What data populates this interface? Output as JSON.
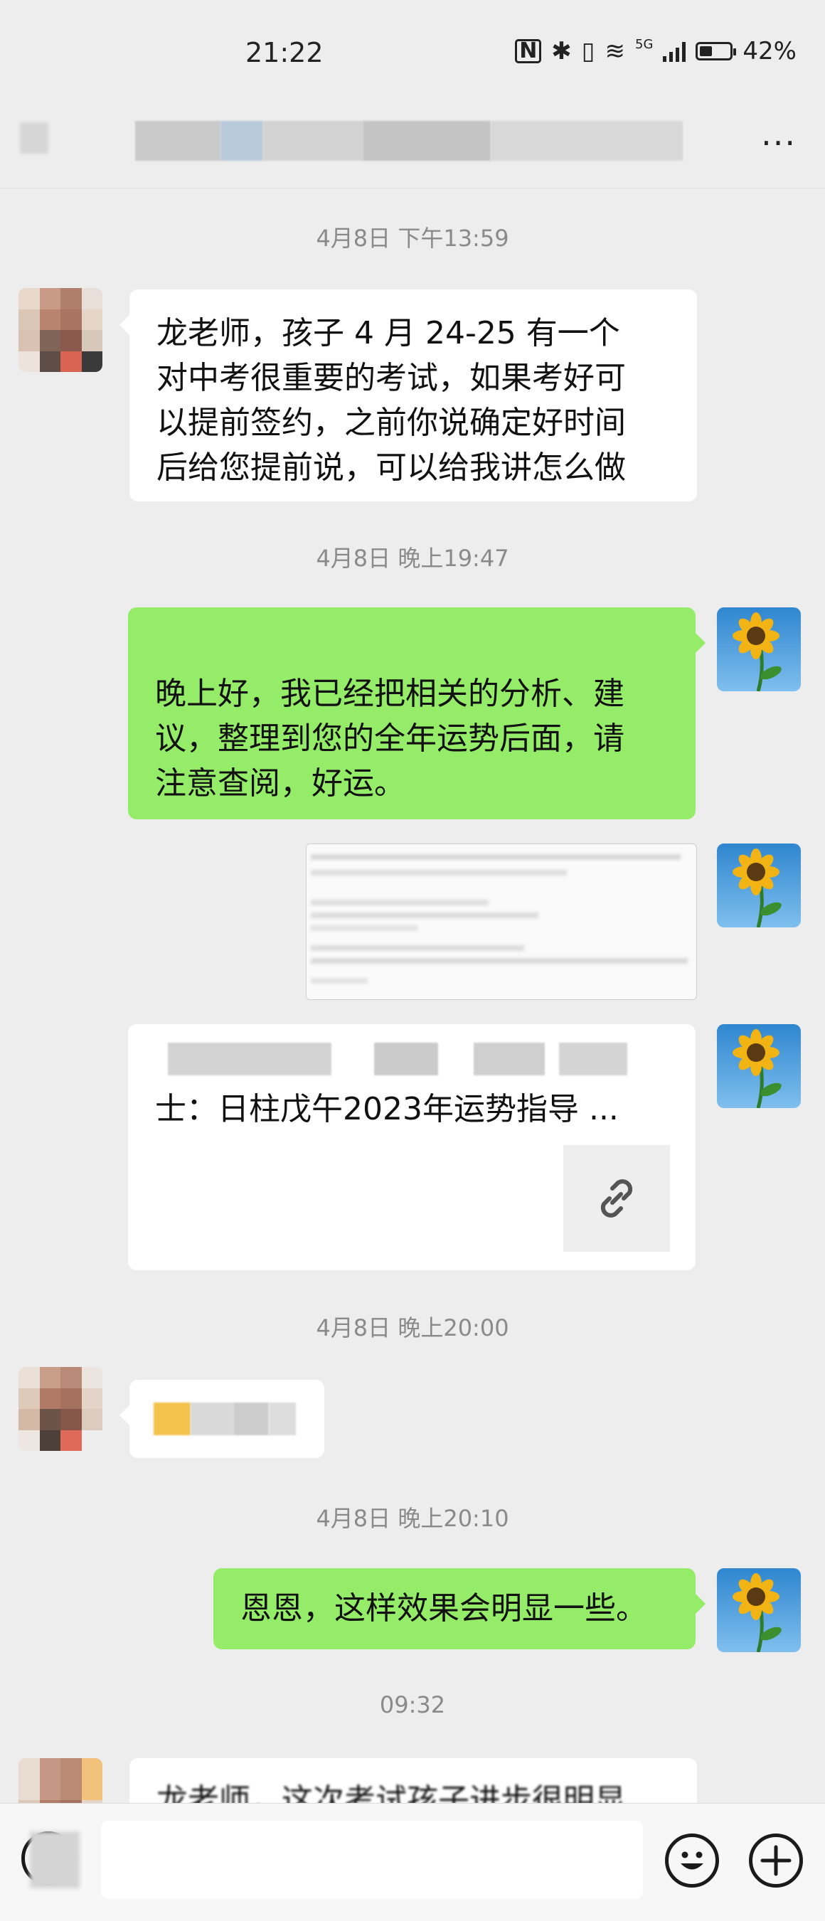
{
  "status_bar": {
    "time": "21:22",
    "network": "5G",
    "battery": "42%",
    "battery_level": 0.42
  },
  "header": {
    "more_label": "···"
  },
  "timestamps": [
    "4月8日 下午13:59",
    "4月8日 晚上19:47",
    "4月8日 晚上20:00",
    "4月8日 晚上20:10",
    "09:32"
  ],
  "messages": {
    "msg1_lines": [
      "龙老师，孩子 4 月 24-25 有一个",
      "对中考很重要的考试，如果考好可",
      "以提前签约，之前你说确定好时间",
      "后给您提前说，可以给我讲怎么做"
    ],
    "msg2_lines": [
      "晚上好，我已经把相关的分析、建",
      "议，整理到您的全年运势后面，请",
      "注意查阅，好运。"
    ],
    "link_card_title": "士：日柱戊午2023年运势指导 ...",
    "msg5": "恩恩，这样效果会明显一些。",
    "msg6_partial": "龙老师，这次考试孩子进步很明显"
  },
  "colors": {
    "background": "#ededed",
    "sent_bubble": "#95ec69",
    "received_bubble": "#ffffff"
  }
}
